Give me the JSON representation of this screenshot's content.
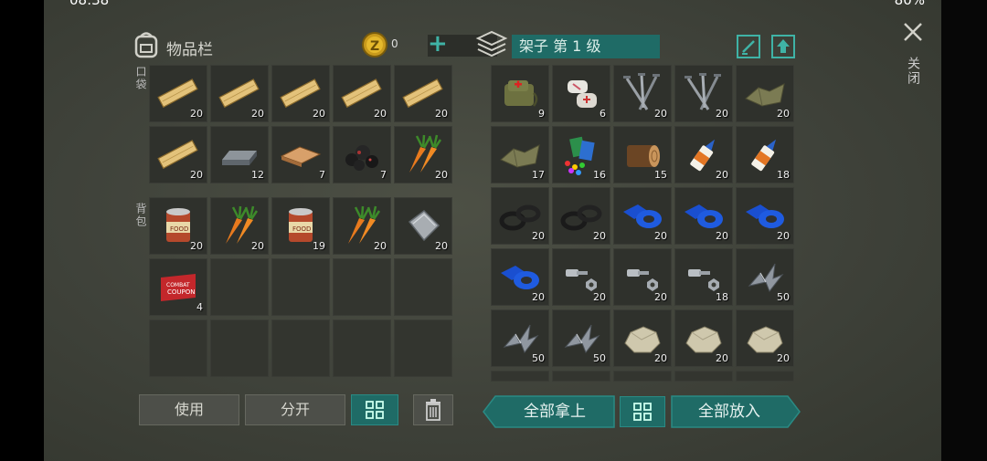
{
  "status": {
    "time": "08:38",
    "battery": "80%"
  },
  "inventory": {
    "title": "物品栏",
    "coins": "0",
    "pocket_label": "口袋",
    "backpack_label": "背包",
    "pocket": [
      {
        "icon": "plank-icon",
        "count": "20"
      },
      {
        "icon": "plank-icon",
        "count": "20"
      },
      {
        "icon": "plank-icon",
        "count": "20"
      },
      {
        "icon": "plank-icon",
        "count": "20"
      },
      {
        "icon": "plank-icon",
        "count": "20"
      },
      {
        "icon": "plank-icon",
        "count": "20"
      },
      {
        "icon": "iron-bar-icon",
        "count": "12"
      },
      {
        "icon": "wood-board-icon",
        "count": "7"
      },
      {
        "icon": "coal-icon",
        "count": "7"
      },
      {
        "icon": "carrot-icon",
        "count": "20"
      }
    ],
    "backpack": [
      {
        "icon": "canned-food-icon",
        "count": "20"
      },
      {
        "icon": "carrot-icon",
        "count": "20"
      },
      {
        "icon": "canned-food-icon",
        "count": "19"
      },
      {
        "icon": "carrot-icon",
        "count": "20"
      },
      {
        "icon": "metal-plate-icon",
        "count": "20"
      },
      {
        "icon": "coupon-icon",
        "count": "4"
      },
      {
        "icon": "",
        "count": ""
      },
      {
        "icon": "",
        "count": ""
      },
      {
        "icon": "",
        "count": ""
      },
      {
        "icon": "",
        "count": ""
      },
      {
        "icon": "",
        "count": ""
      },
      {
        "icon": "",
        "count": ""
      },
      {
        "icon": "",
        "count": ""
      },
      {
        "icon": "",
        "count": ""
      },
      {
        "icon": "",
        "count": ""
      }
    ],
    "buttons": {
      "use": "使用",
      "split": "分开"
    }
  },
  "shelf": {
    "title": "架子 第 1 级",
    "items": [
      {
        "icon": "first-aid-bag-icon",
        "count": "9"
      },
      {
        "icon": "bandage-icon",
        "count": "6"
      },
      {
        "icon": "nails-icon",
        "count": "20"
      },
      {
        "icon": "nails-icon",
        "count": "20"
      },
      {
        "icon": "cloth-icon",
        "count": "20"
      },
      {
        "icon": "cloth-icon",
        "count": "17"
      },
      {
        "icon": "colorful-fabric-icon",
        "count": "16"
      },
      {
        "icon": "log-icon",
        "count": "15"
      },
      {
        "icon": "glue-icon",
        "count": "20"
      },
      {
        "icon": "glue-icon",
        "count": "18"
      },
      {
        "icon": "rubber-ring-icon",
        "count": "20"
      },
      {
        "icon": "rubber-ring-icon",
        "count": "20"
      },
      {
        "icon": "blue-tape-icon",
        "count": "20"
      },
      {
        "icon": "blue-tape-icon",
        "count": "20"
      },
      {
        "icon": "blue-tape-icon",
        "count": "20"
      },
      {
        "icon": "blue-tape-icon",
        "count": "20"
      },
      {
        "icon": "bolt-nut-icon",
        "count": "20"
      },
      {
        "icon": "bolt-nut-icon",
        "count": "20"
      },
      {
        "icon": "bolt-nut-icon",
        "count": "18"
      },
      {
        "icon": "scrap-metal-icon",
        "count": "50"
      },
      {
        "icon": "scrap-metal-icon",
        "count": "50"
      },
      {
        "icon": "scrap-metal-icon",
        "count": "50"
      },
      {
        "icon": "stone-icon",
        "count": "20"
      },
      {
        "icon": "stone-icon",
        "count": "20"
      },
      {
        "icon": "stone-icon",
        "count": "20"
      }
    ],
    "buttons": {
      "take_all": "全部拿上",
      "put_all": "全部放入"
    }
  },
  "close_label": "关闭"
}
